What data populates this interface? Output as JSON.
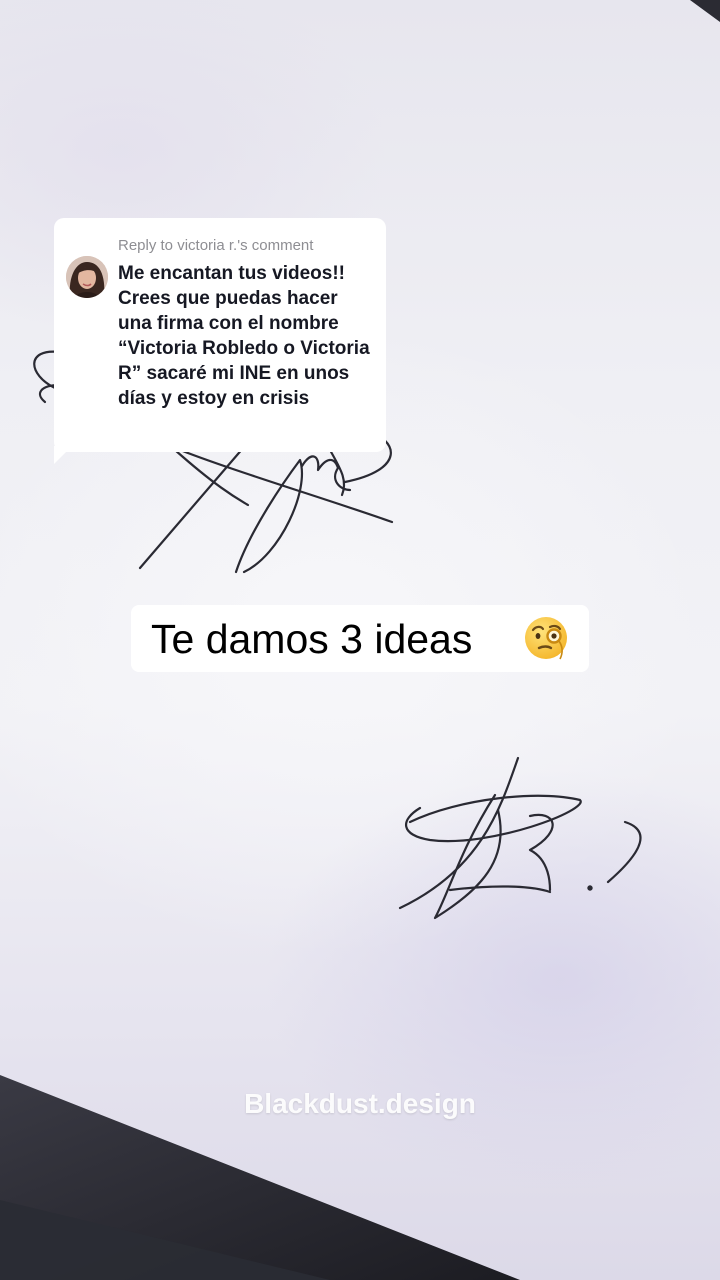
{
  "reply": {
    "header": "Reply to victoria r.'s comment",
    "comment": "Me encantan tus videos!! Crees que puedas hacer una firma con el nombre “Victoria Robledo o Victoria R” sacaré mi INE en unos días y estoy en crisis"
  },
  "overlay": {
    "ideas_text": "Te damos 3 ideas",
    "ideas_emoji": "face-with-monocle-icon"
  },
  "watermark": {
    "text": "Blackdust.design"
  },
  "colors": {
    "ink": "#2a2a33",
    "bubble": "#ffffff",
    "comment_text": "#161823",
    "header_text": "#8e8e93"
  }
}
